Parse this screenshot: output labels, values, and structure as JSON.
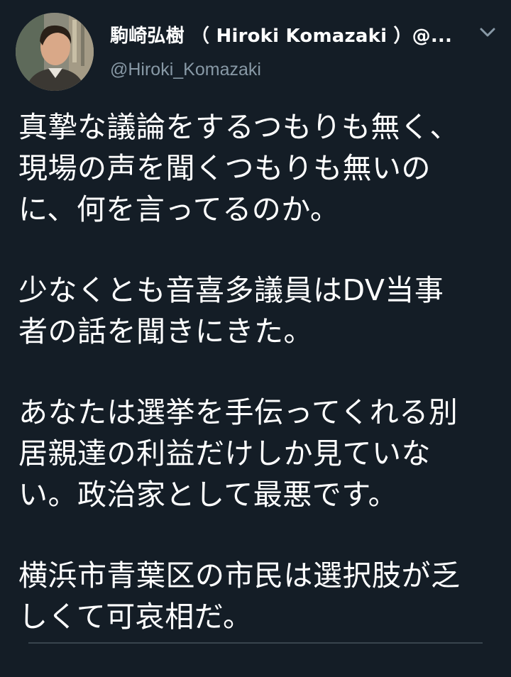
{
  "tweet": {
    "author_name": "駒崎弘樹 （ Hiroki Komazaki ）@...",
    "author_handle": "@Hiroki_Komazaki",
    "more_icon": "chevron-down-icon",
    "avatar": "profile-photo",
    "paragraphs": [
      {
        "lines": [
          "真摯な議論をするつもりも無く、",
          "現場の声を聞くつもりも無いの",
          "に、何を言ってるのか。"
        ]
      },
      {
        "lines": [
          "少なくとも音喜多議員はDV当事",
          "者の話を聞きにきた。"
        ]
      },
      {
        "lines": [
          "あなたは選挙を手伝ってくれる別",
          "居親達の利益だけしか見ていな",
          "い。政治家として最悪です。"
        ]
      },
      {
        "lines": [
          "横浜市青葉区の市民は選択肢が乏",
          "しくて可哀相だ。"
        ]
      }
    ]
  },
  "colors": {
    "background": "#141d26",
    "text": "#ffffff",
    "secondary_text": "#8899a6"
  }
}
